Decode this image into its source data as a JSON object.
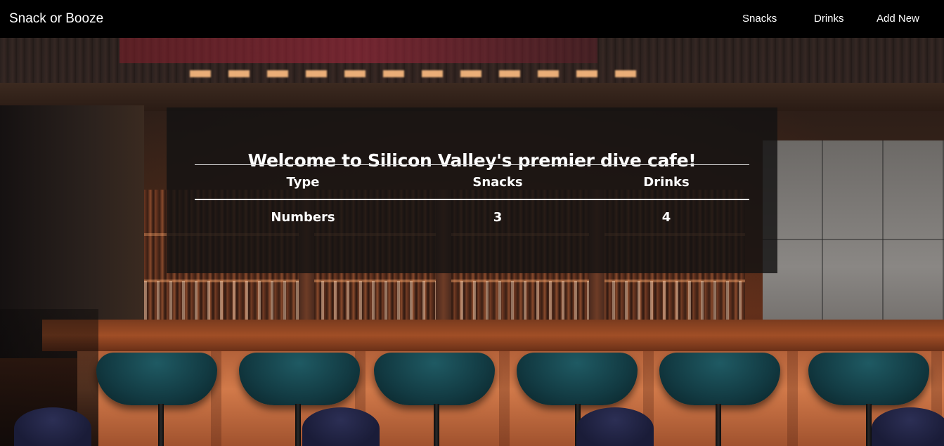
{
  "navbar": {
    "brand": "Snack or Booze",
    "links": [
      "Snacks",
      "Drinks",
      "Add New"
    ]
  },
  "welcome": {
    "title": "Welcome to Silicon Valley's premier dive cafe!",
    "table": {
      "headers": [
        "Type",
        "Snacks",
        "Drinks"
      ],
      "rows": [
        [
          "Numbers",
          "3",
          "4"
        ]
      ]
    }
  },
  "colors": {
    "navbar_bg": "#000000",
    "card_bg": "#141212",
    "text": "#ffffff"
  },
  "background": {
    "image": "bar-interior"
  }
}
